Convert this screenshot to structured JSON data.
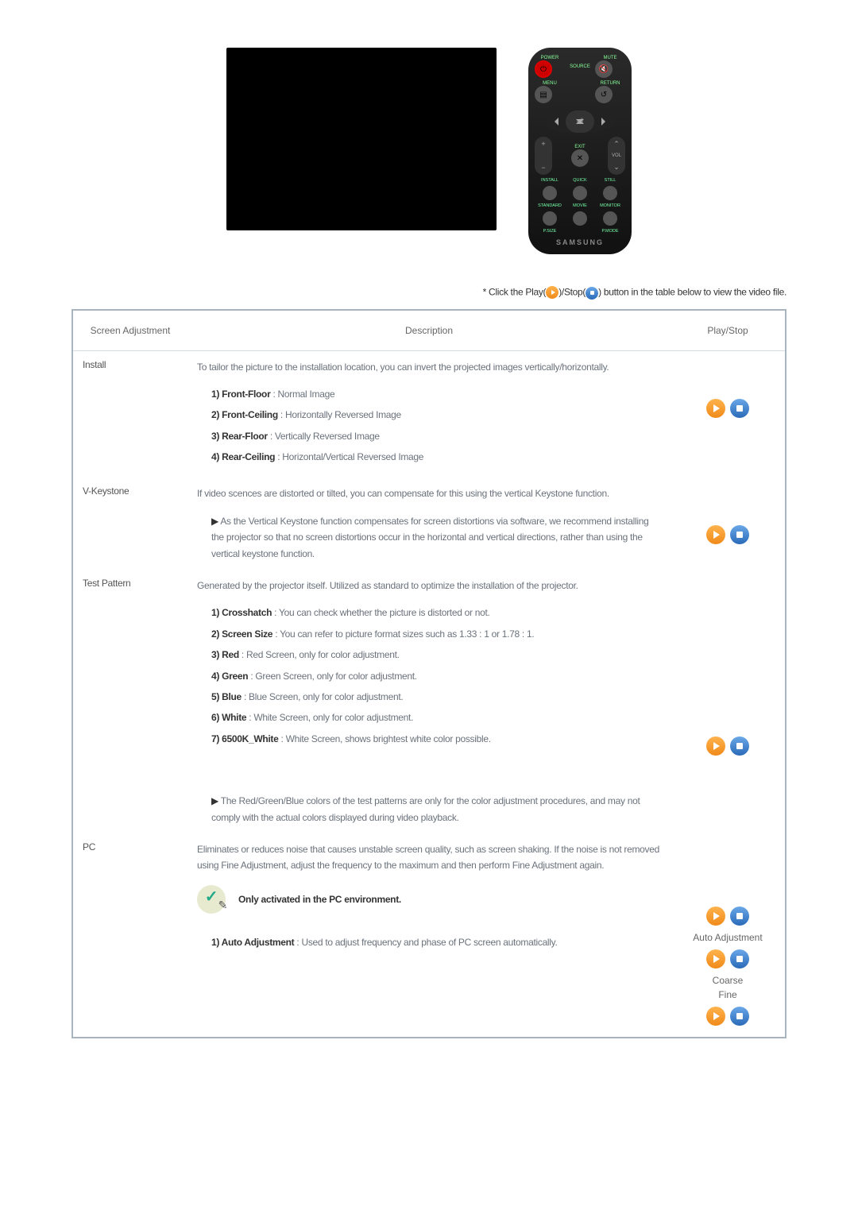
{
  "note": {
    "prefix": "* Click the Play(",
    "mid": ")/Stop(",
    "suffix": ") button in the table below to view the video file."
  },
  "remote": {
    "power": "POWER",
    "source": "SOURCE",
    "mute": "MUTE",
    "menu": "MENU",
    "return": "RETURN",
    "exit": "EXIT",
    "vol": "VOL",
    "keystone": "KEYSTONE",
    "install": "INSTALL",
    "quick": "QUICK",
    "still": "STILL",
    "standard": "STANDARD",
    "movie": "MOVIE",
    "monitor": "MONITOR",
    "psize": "P.SIZE",
    "pmode": "P.MODE",
    "brand": "SAMSUNG"
  },
  "table": {
    "headers": {
      "col1": "Screen Adjustment",
      "col2": "Description",
      "col3": "Play/Stop"
    },
    "rows": {
      "install": {
        "name": "Install",
        "intro": "To tailor the picture to the installation location, you can invert the projected images vertically/horizontally.",
        "items": [
          {
            "b": "1) Front-Floor",
            "t": " : Normal Image"
          },
          {
            "b": "2) Front-Ceiling",
            "t": " : Horizontally Reversed Image"
          },
          {
            "b": "3) Rear-Floor",
            "t": " : Vertically Reversed Image"
          },
          {
            "b": "4) Rear-Ceiling",
            "t": " : Horizontal/Vertical Reversed Image"
          }
        ]
      },
      "vkeystone": {
        "name": "V-Keystone",
        "intro": "If video scences are distorted or tilted, you can compensate for this using the vertical Keystone function.",
        "bullet": "As the Vertical Keystone function compensates for screen distortions via software, we recommend installing the projector so that no screen distortions occur in the horizontal and vertical directions, rather than using the vertical keystone function."
      },
      "testpattern": {
        "name": "Test Pattern",
        "intro": "Generated by the projector itself. Utilized as standard to optimize the installation of the projector.",
        "items": [
          {
            "b": "1) Crosshatch",
            "t": " : You can check whether the picture is distorted or not."
          },
          {
            "b": "2) Screen Size",
            "t": " : You can refer to picture format sizes such as 1.33 : 1 or 1.78 : 1."
          },
          {
            "b": "3) Red",
            "t": " : Red Screen, only for color adjustment."
          },
          {
            "b": "4) Green",
            "t": " : Green Screen, only for color adjustment."
          },
          {
            "b": "5) Blue",
            "t": " : Blue Screen, only for color adjustment."
          },
          {
            "b": "6) White",
            "t": " : White Screen, only for color adjustment."
          },
          {
            "b": "7) 6500K_White",
            "t": " : White Screen, shows brightest white color possible."
          }
        ],
        "bullet": "The Red/Green/Blue colors of the test patterns are only for the color adjustment procedures, and may not comply with the actual colors displayed during video playback."
      },
      "pc": {
        "name": "PC",
        "intro": "Eliminates or reduces noise that causes unstable screen quality, such as screen shaking. If the noise is not removed using Fine Adjustment, adjust the frequency to the maximum and then perform Fine Adjustment again.",
        "note": "Only activated in the PC environment.",
        "items": [
          {
            "b": "1) Auto Adjustment",
            "t": " : Used to adjust frequency and phase of PC screen automatically."
          }
        ],
        "labels": {
          "auto": "Auto Adjustment",
          "coarse": "Coarse",
          "fine": "Fine"
        }
      }
    }
  }
}
